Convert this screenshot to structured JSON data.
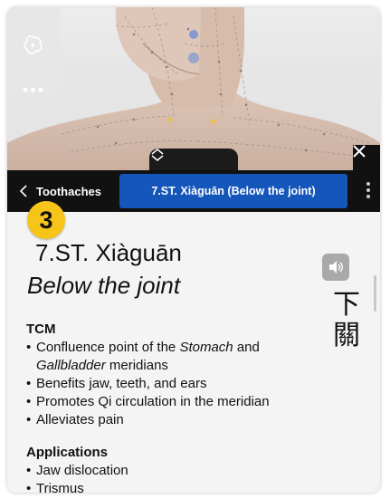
{
  "viewport": {
    "acupoint_dot_color": "#f2c12e",
    "meridian_point_color": "#6a8fd6",
    "skin_color": "#d9bfae"
  },
  "side_panel": {
    "icons": [
      "anatomy-view-icon",
      "more-dots-icon"
    ]
  },
  "navbar": {
    "back_label": "Toothaches",
    "active_tab_label": "7.ST. Xiàguān (Below the joint)",
    "active_tab_color": "#1456ba"
  },
  "content": {
    "step_number": "3",
    "step_badge_color": "#f7c419",
    "point_name": "7.ST. Xiàguān",
    "point_subtitle": "Below the joint",
    "hanzi": [
      "下",
      "關"
    ],
    "tcm": {
      "heading": "TCM",
      "items": [
        {
          "pre": "Confluence point of the ",
          "em1": "Stomach",
          "mid": " and ",
          "em2": "Gallbladder",
          "post": " meridians"
        },
        {
          "text": "Benefits jaw, teeth, and ears"
        },
        {
          "text": "Promotes Qi circulation in the meridian"
        },
        {
          "text": "Alleviates pain"
        }
      ]
    },
    "applications": {
      "heading": "Applications",
      "items": [
        "Jaw dislocation",
        "Trismus"
      ]
    }
  }
}
